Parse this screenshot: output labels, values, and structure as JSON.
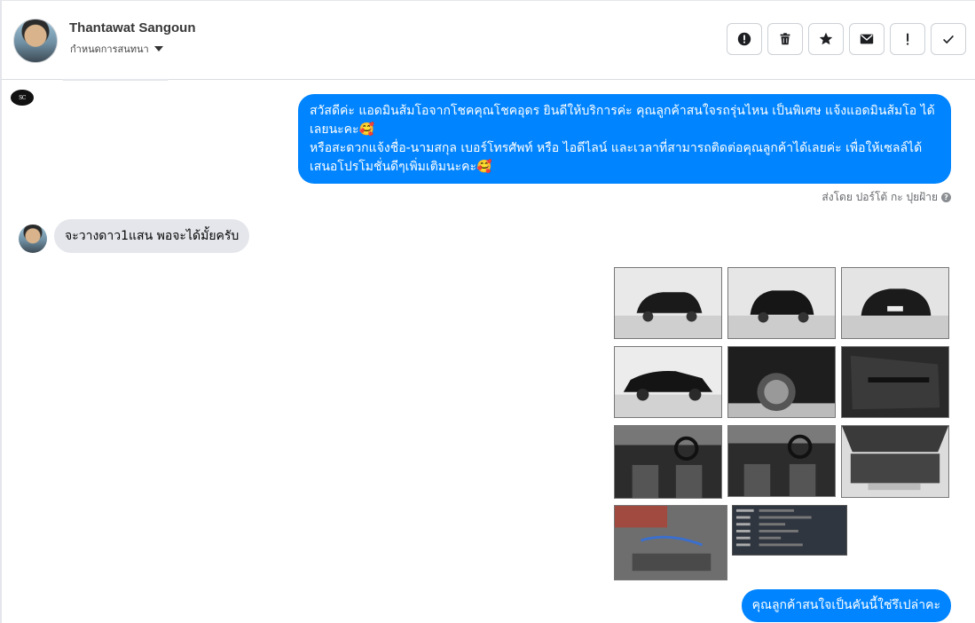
{
  "header": {
    "contact_name": "Thantawat Sangoun",
    "contact_sub": "กำหนดการสนทนา",
    "toolbar": [
      {
        "name": "alert-icon",
        "label": "!"
      },
      {
        "name": "trash-icon",
        "label": ""
      },
      {
        "name": "star-icon",
        "label": ""
      },
      {
        "name": "envelope-icon",
        "label": ""
      },
      {
        "name": "exclamation-icon",
        "label": "!"
      },
      {
        "name": "check-icon",
        "label": ""
      }
    ]
  },
  "messages": {
    "outgoing_1": {
      "line_1": "สวัสดีค่ะ แอดมินส้มโอจากโชคคุณโชคอุดร ยินดีให้บริการค่ะ   คุณลูกค้าสนใจรถรุ่นไหน เป็นพิเศษ แจ้งแอดมินส้มโอ ได้เลยนะคะ🥰",
      "line_2": "หรือสะดวกแจ้งชื่อ-นามสกุล เบอร์โทรศัพท์ หรือ ไอดีไลน์ และเวลาที่สามารถติดต่อคุณลูกค้าได้เลยค่ะ เพื่อให้เซลล์ได้เสนอโปรโมชั่นดีๆเพิ่มเติมนะคะ🥰"
    },
    "sent_by": "ส่งโดย ปอร์โต้ กะ ปุยฝ้าย",
    "sent_by_icon": "?",
    "incoming_1": "จะวางดาว1แสน พอจะได้มั้ยครับ",
    "outgoing_2": "คุณลูกค้าสนใจเป็นคันนี้ใช่รึเปล่าคะ"
  },
  "page_logo": "SC",
  "colors": {
    "accent": "#0084ff",
    "incoming_bubble": "#e4e6eb",
    "border": "#ccd0d5"
  },
  "photos": [
    {
      "name": "car-front-left-photo"
    },
    {
      "name": "car-rear-left-photo"
    },
    {
      "name": "car-rear-photo"
    },
    {
      "name": "car-side-photo"
    },
    {
      "name": "car-wheel-photo"
    },
    {
      "name": "car-door-interior-photo"
    },
    {
      "name": "car-dashboard-photo"
    },
    {
      "name": "car-dashboard-2-photo"
    },
    {
      "name": "car-engine-photo"
    },
    {
      "name": "car-chassis-photo"
    },
    {
      "name": "car-document-screenshot"
    }
  ]
}
